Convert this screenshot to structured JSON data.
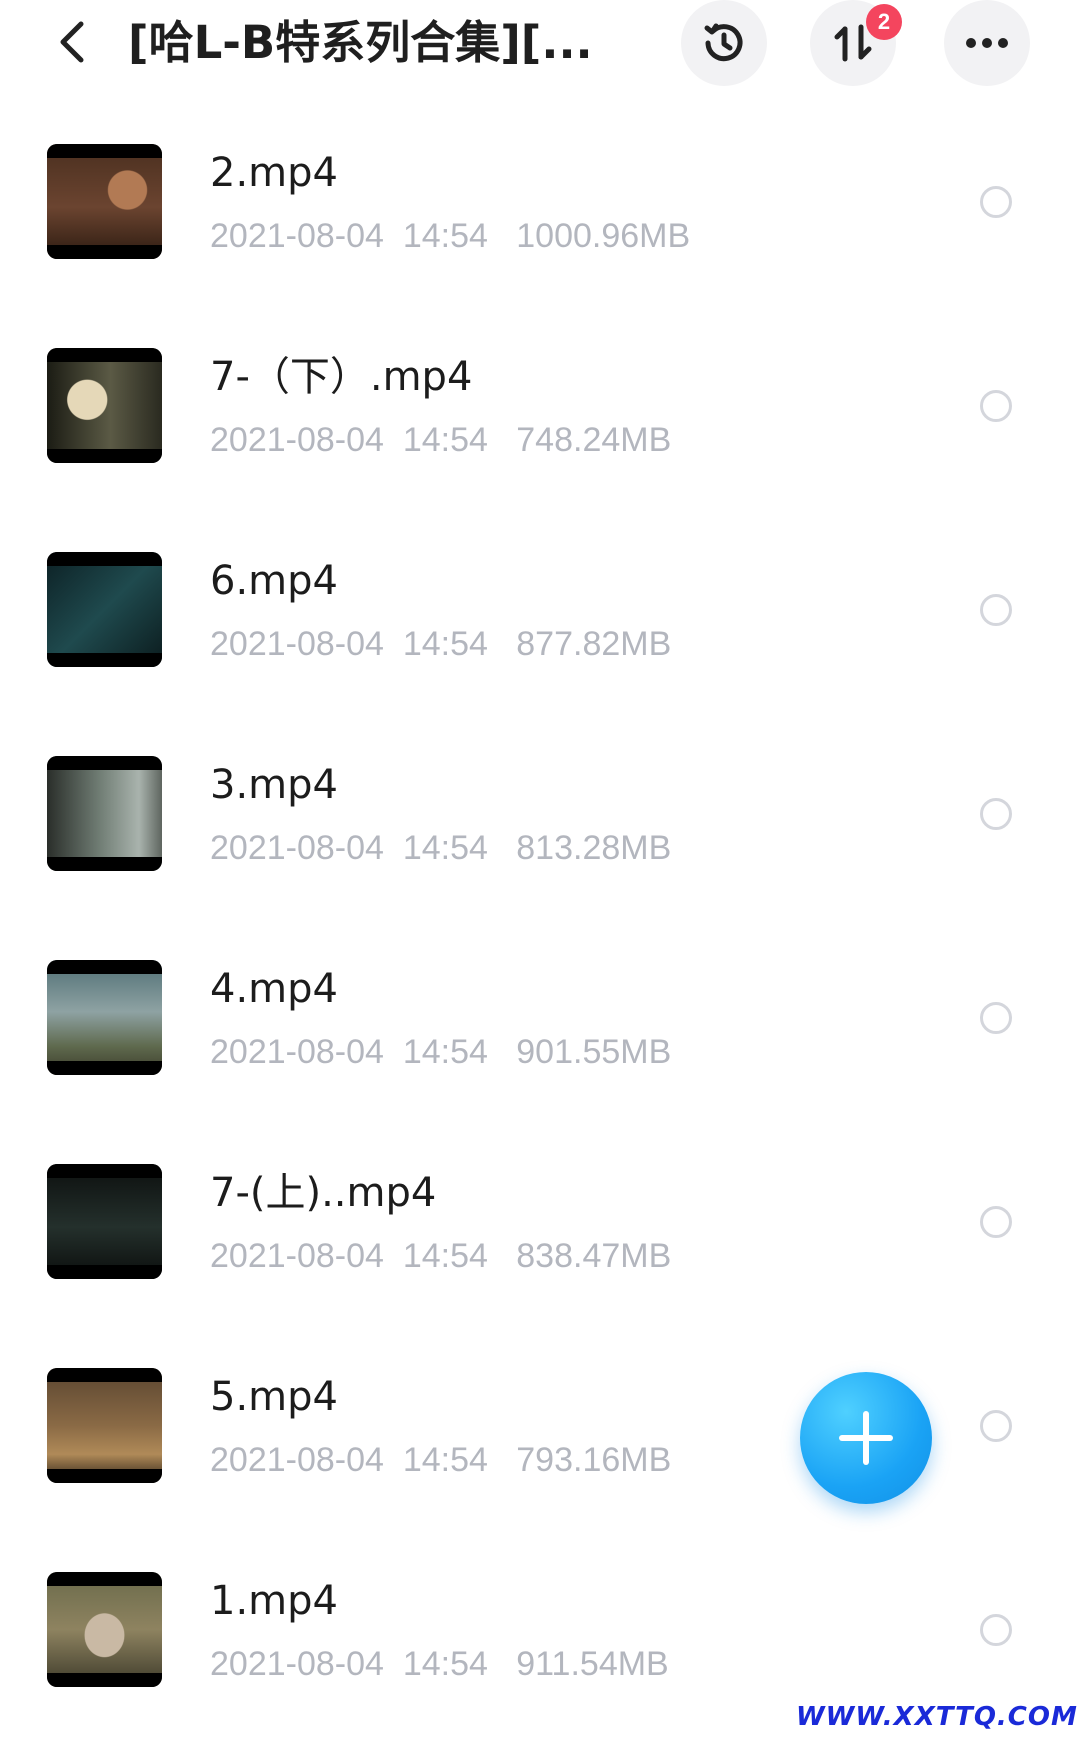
{
  "header": {
    "title": "[哈L-B特系列合集][...",
    "transfer_badge_count": "2",
    "icons": {
      "back": "back-arrow-icon",
      "history": "history-icon",
      "transfer": "transfer-icon",
      "more": "more-icon"
    }
  },
  "files": [
    {
      "name": "2.mp4",
      "date": "2021-08-04",
      "time": "14:54",
      "size": "1000.96MB",
      "thumb_class": "t1"
    },
    {
      "name": "7-（下）.mp4",
      "date": "2021-08-04",
      "time": "14:54",
      "size": "748.24MB",
      "thumb_class": "t2"
    },
    {
      "name": "6.mp4",
      "date": "2021-08-04",
      "time": "14:54",
      "size": "877.82MB",
      "thumb_class": "t3"
    },
    {
      "name": "3.mp4",
      "date": "2021-08-04",
      "time": "14:54",
      "size": "813.28MB",
      "thumb_class": "t4"
    },
    {
      "name": "4.mp4",
      "date": "2021-08-04",
      "time": "14:54",
      "size": "901.55MB",
      "thumb_class": "t5"
    },
    {
      "name": "7-(上)..mp4",
      "date": "2021-08-04",
      "time": "14:54",
      "size": "838.47MB",
      "thumb_class": "t6"
    },
    {
      "name": "5.mp4",
      "date": "2021-08-04",
      "time": "14:54",
      "size": "793.16MB",
      "thumb_class": "t7"
    },
    {
      "name": "1.mp4",
      "date": "2021-08-04",
      "time": "14:54",
      "size": "911.54MB",
      "thumb_class": "t8"
    }
  ],
  "fab": {
    "icon": "plus-icon"
  },
  "watermark": "WWW.XXTTQ.COM",
  "colors": {
    "accent": "#1aa3f5",
    "badge": "#f4455e",
    "meta_text": "#b3b6be"
  }
}
